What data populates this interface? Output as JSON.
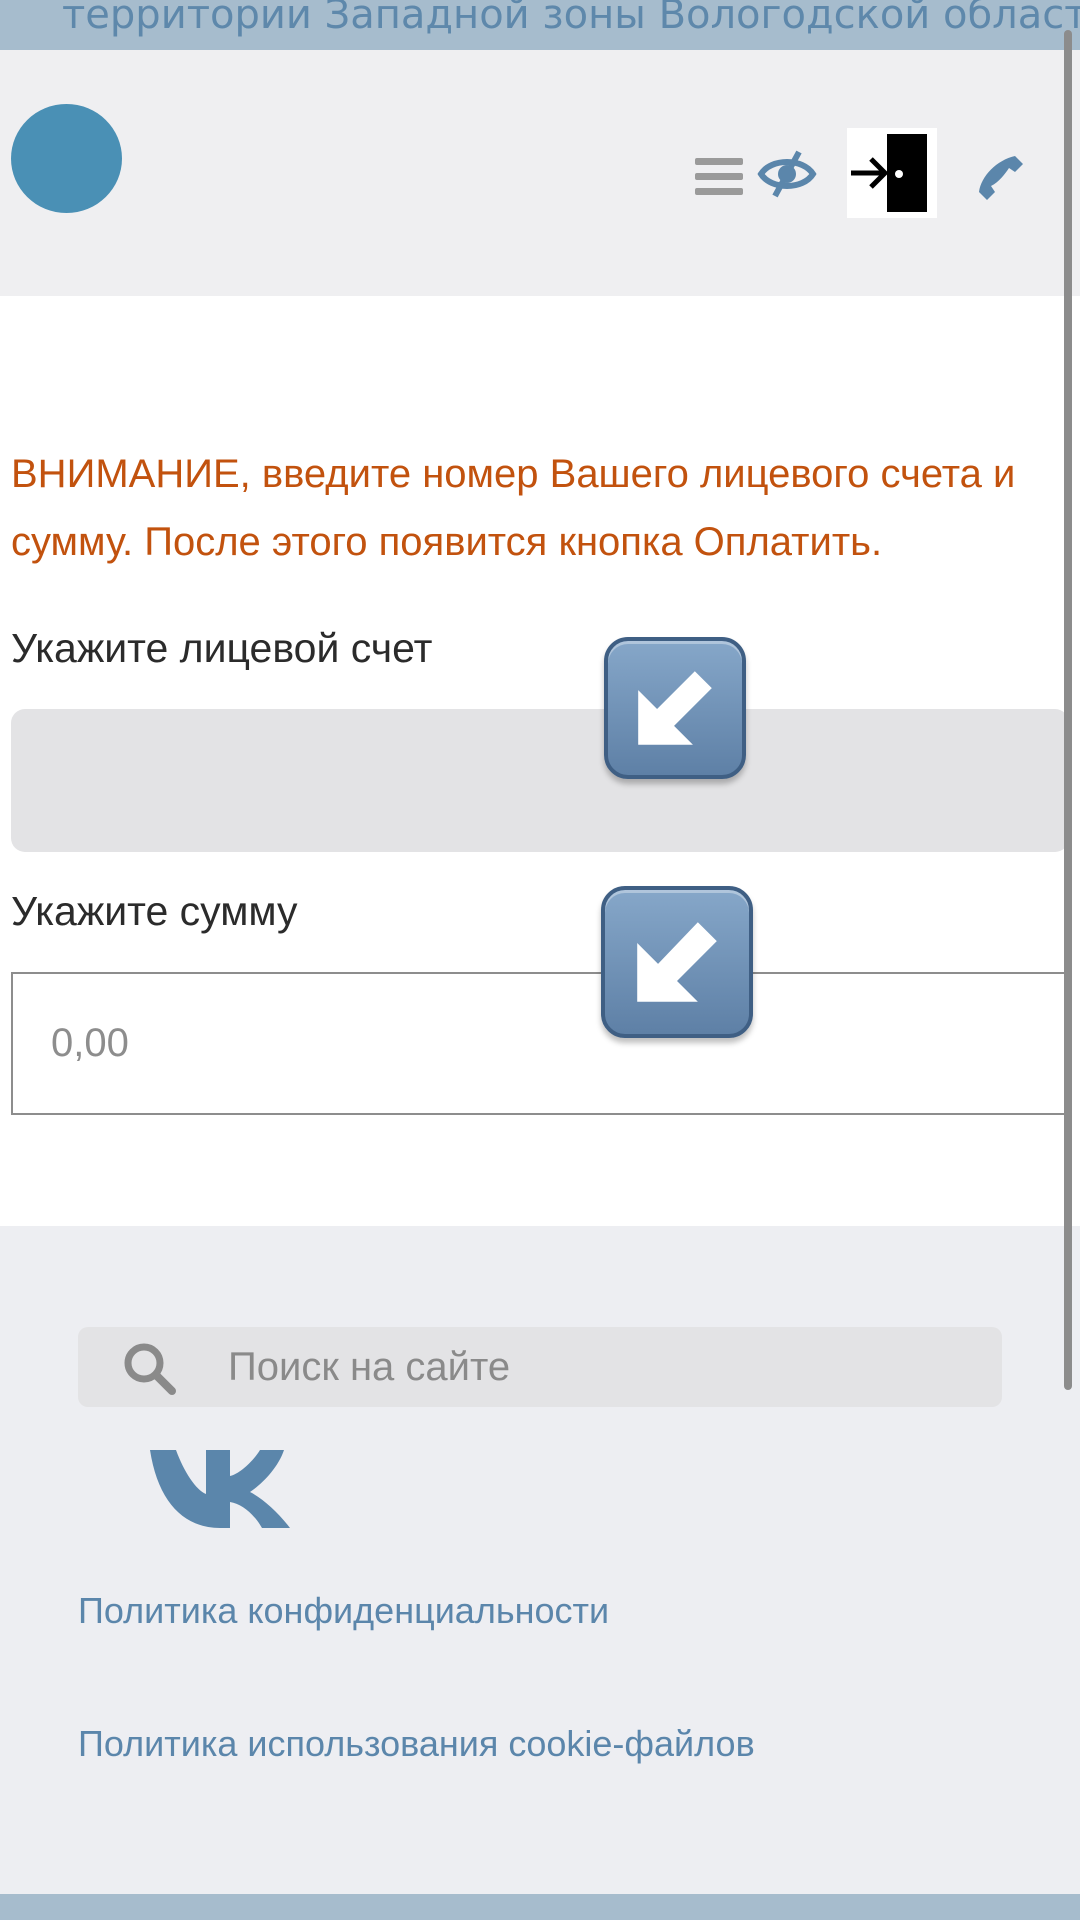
{
  "top_banner": {
    "text": "территории Западной зоны Вологодской области"
  },
  "header": {
    "icons": [
      "menu-icon",
      "eye-slash-icon",
      "exit-icon",
      "phone-icon"
    ],
    "logo_color": "#4a90b5",
    "accent_color": "#5b86ab"
  },
  "main": {
    "notice": "ВНИМАНИЕ, введите номер Вашего лицевого счета и сумму. После этого появится кнопка Оплатить.",
    "account_label": "Укажите лицевой счет",
    "account_value": "",
    "sum_label": "Укажите сумму",
    "sum_placeholder": "0,00",
    "notice_color": "#c2520e"
  },
  "footer": {
    "search_placeholder": "Поиск на сайте",
    "privacy_link": "Политика конфиденциальности",
    "cookie_link": "Политика использования cookie-файлов"
  }
}
